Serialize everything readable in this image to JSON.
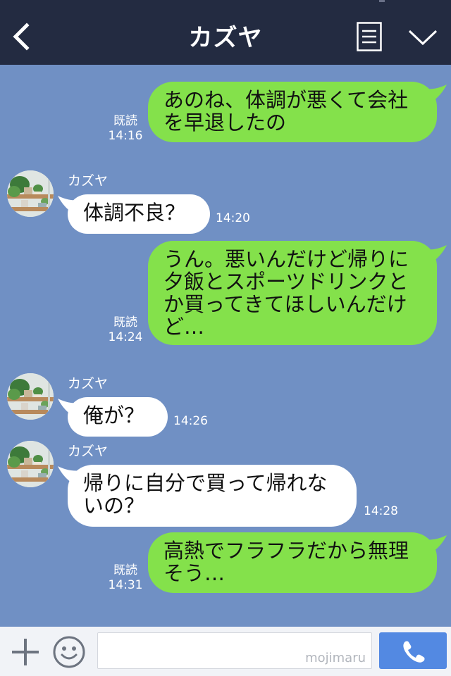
{
  "header": {
    "title": "カズヤ",
    "back_icon": "chevron-left-icon",
    "menu_icon": "notes-icon",
    "more_icon": "chevron-down-icon"
  },
  "messages": [
    {
      "direction": "out",
      "lines": [
        "あのね、体調が悪くて会社",
        "を早退したの"
      ],
      "read": "既読",
      "time": "14:16"
    },
    {
      "direction": "in",
      "sender": "カズヤ",
      "lines": [
        "体調不良？"
      ],
      "time": "14:20"
    },
    {
      "direction": "out",
      "lines": [
        "うん。悪いんだけど帰りに",
        "夕飯とスポーツドリンクと",
        "か買ってきてほしいんだけ",
        "ど…"
      ],
      "read": "既読",
      "time": "14:24"
    },
    {
      "direction": "in",
      "sender": "カズヤ",
      "lines": [
        "俺が？"
      ],
      "time": "14:26"
    },
    {
      "direction": "in",
      "sender": "カズヤ",
      "lines": [
        "帰りに自分で買って帰れな",
        "いの？"
      ],
      "time": "14:28"
    },
    {
      "direction": "out",
      "lines": [
        "高熱でフラフラだから無理",
        "そう…"
      ],
      "read": "既読",
      "time": "14:31"
    }
  ],
  "footer": {
    "input_value": "",
    "watermark": "mojimaru",
    "plus_icon": "plus-icon",
    "emoji_icon": "smile-icon",
    "call_icon": "phone-icon"
  },
  "colors": {
    "header_bg": "#232b41",
    "chat_bg": "#7090c4",
    "outgoing_bubble": "#84e14b",
    "incoming_bubble": "#ffffff",
    "call_button": "#5389e2"
  }
}
